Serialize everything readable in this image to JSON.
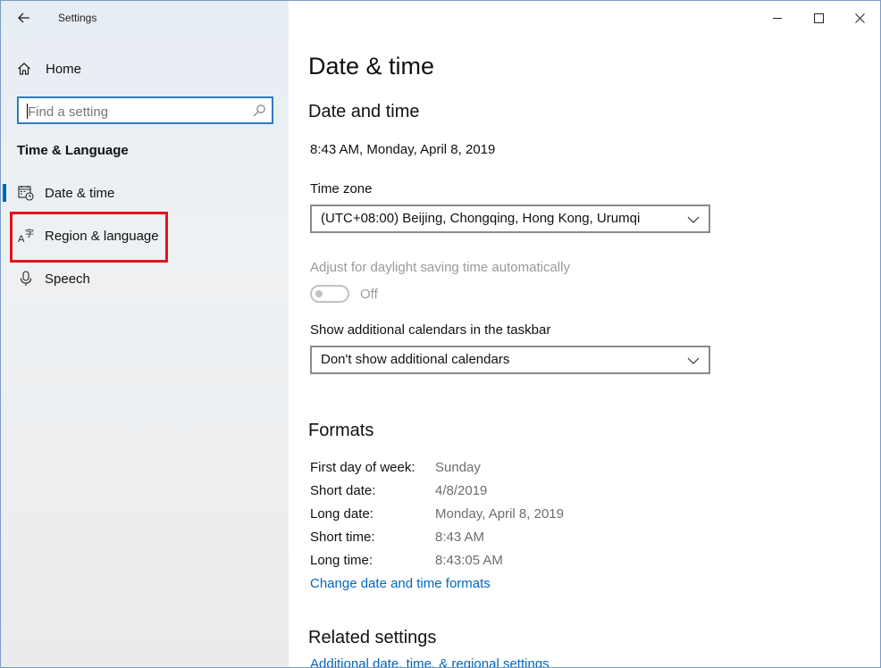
{
  "window": {
    "title": "Settings"
  },
  "sidebar": {
    "home_label": "Home",
    "search_placeholder": "Find a setting",
    "section_title": "Time & Language",
    "items": [
      {
        "label": "Date & time",
        "icon": "calendar-clock-icon",
        "selected": true
      },
      {
        "label": "Region & language",
        "icon": "language-icon",
        "selected": false
      },
      {
        "label": "Speech",
        "icon": "microphone-icon",
        "selected": false
      }
    ],
    "highlight_color": "#e0141e"
  },
  "main": {
    "page_title": "Date & time",
    "date_and_time_heading": "Date and time",
    "current_datetime": "8:43 AM, Monday, April 8, 2019",
    "time_zone_label": "Time zone",
    "time_zone_value": "(UTC+08:00) Beijing, Chongqing, Hong Kong, Urumqi",
    "dst_label": "Adjust for daylight saving time automatically",
    "dst_state": "Off",
    "calendars_label": "Show additional calendars in the taskbar",
    "calendars_value": "Don't show additional calendars",
    "formats_heading": "Formats",
    "formats": [
      {
        "key": "First day of week:",
        "value": "Sunday"
      },
      {
        "key": "Short date:",
        "value": "4/8/2019"
      },
      {
        "key": "Long date:",
        "value": "Monday, April 8, 2019"
      },
      {
        "key": "Short time:",
        "value": "8:43 AM"
      },
      {
        "key": "Long time:",
        "value": "8:43:05 AM"
      }
    ],
    "change_formats_link": "Change date and time formats",
    "related_heading": "Related settings",
    "related_link": "Additional date, time, & regional settings"
  },
  "colors": {
    "accent": "#0067c0",
    "search_border": "#2d7cc4"
  }
}
